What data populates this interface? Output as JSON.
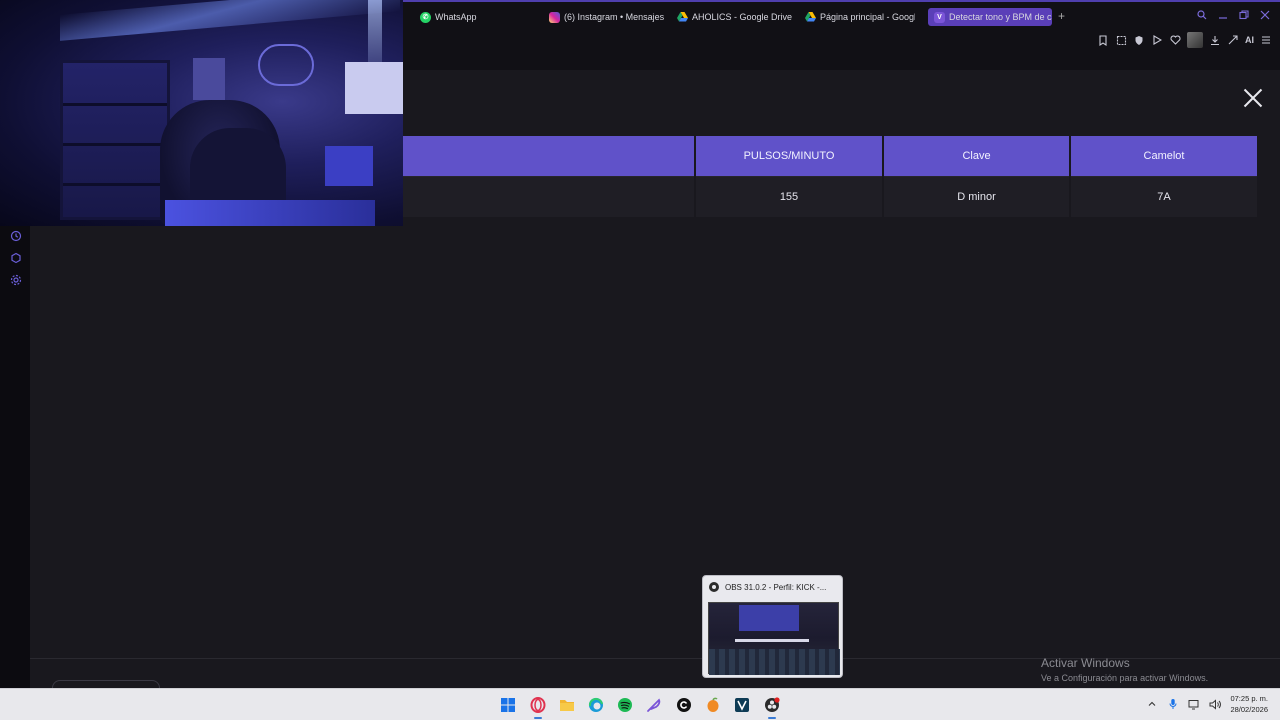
{
  "browser": {
    "tabs": [
      {
        "label": "WhatsApp",
        "icon": "whatsapp-icon",
        "color": "#25d366",
        "active": false
      },
      {
        "label": "(6) Instagram • Mensajes",
        "icon": "instagram-icon",
        "color": "#d6249f",
        "active": false
      },
      {
        "label": "AHOLICS - Google Drive",
        "icon": "google-drive-icon",
        "color": "#1fa463",
        "active": false
      },
      {
        "label": "Página principal - Google",
        "icon": "google-drive-icon",
        "color": "#1fa463",
        "active": false
      },
      {
        "label": "Detectar tono y BPM de ca",
        "icon": "vocalremover-icon",
        "color": "#6b3fd0",
        "active": true
      }
    ],
    "ai_label": "AI",
    "accent": "#5a3fb8"
  },
  "results": {
    "headers": [
      "",
      "PULSOS/MINUTO",
      "Clave",
      "Camelot"
    ],
    "rows": [
      [
        "",
        "155",
        "D minor",
        "7A"
      ]
    ],
    "header_color": "#6052c9"
  },
  "watermark": {
    "line1": "Activar Windows",
    "line2": "Ve a Configuración para activar Windows."
  },
  "preview": {
    "title": "OBS 31.0.2 - Perfil: KICK -..."
  },
  "taskbar": {
    "apps": [
      {
        "name": "start-button",
        "color": "#1a73e8"
      },
      {
        "name": "opera-icon",
        "color": "#e0324f"
      },
      {
        "name": "file-explorer-icon",
        "color": "#f2b531"
      },
      {
        "name": "edge-icon",
        "color": "#1a9bd7"
      },
      {
        "name": "spotify-icon",
        "color": "#1db954"
      },
      {
        "name": "feather-app-icon",
        "color": "#7b55d8"
      },
      {
        "name": "capcut-icon",
        "color": "#111111"
      },
      {
        "name": "fl-studio-icon",
        "color": "#f08a24"
      },
      {
        "name": "vegas-icon",
        "color": "#0e3b55"
      },
      {
        "name": "obs-icon",
        "color": "#2b2b2b"
      }
    ],
    "time": "07:25 p. m.",
    "date": "28/02/2026"
  }
}
